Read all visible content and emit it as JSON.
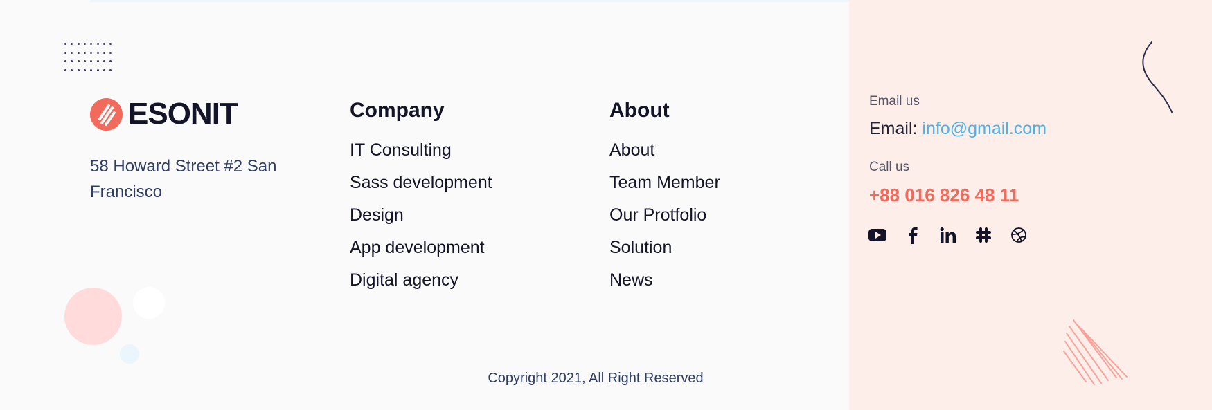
{
  "brand": {
    "name": "ESONIT",
    "accent": "#f26a5b"
  },
  "address": "58 Howard Street #2 San Francisco",
  "company": {
    "title": "Company",
    "items": [
      "IT Consulting",
      "Sass development",
      "Design",
      "App development",
      "Digital agency"
    ]
  },
  "about": {
    "title": "About",
    "items": [
      "About",
      "Team Member",
      "Our Protfolio",
      "Solution",
      "News"
    ]
  },
  "contact": {
    "email_label": "Email us",
    "email_prefix": "Email:",
    "email": "info@gmail.com",
    "call_label": "Call us",
    "phone": "+88 016 826 48 11"
  },
  "socials": [
    "youtube-icon",
    "facebook-icon",
    "linkedin-icon",
    "slack-icon",
    "dribbble-icon"
  ],
  "copyright": "Copyright 2021, All Right Reserved",
  "colors": {
    "panel": "#fdeeea",
    "link": "#4cb3ea",
    "text": "#141428",
    "muted": "#2e3d66"
  }
}
